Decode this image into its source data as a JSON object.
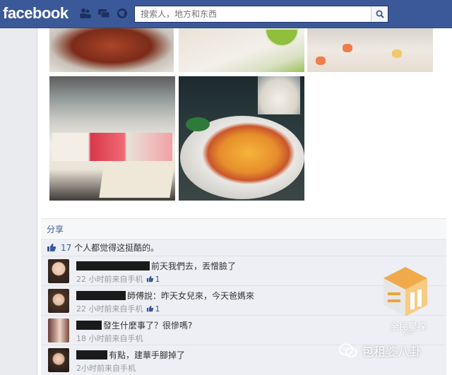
{
  "header": {
    "logo": "facebook",
    "search_placeholder": "搜索人，地方和东西"
  },
  "post": {
    "share_label": "分享",
    "likes_count": "17",
    "likes_suffix": "个人都觉得这挺酷的。"
  },
  "comments": [
    {
      "text": "前天我們去，丟憎臉了",
      "time": "22 小时前来自手机",
      "likes": "1"
    },
    {
      "text": "師傅說：昨天女兒來，今天爸媽來",
      "time": "22 小时前来自手机",
      "likes": "1"
    },
    {
      "text": "發生什麼事了？很慘嗎?",
      "time": "18 小时前来自手机",
      "likes": ""
    },
    {
      "text": "有點，建華手腳掉了",
      "time": "2小时前来自手机",
      "likes": ""
    }
  ],
  "watermark": {
    "app_name": "全民星探",
    "app_tag": "APP",
    "account": "包租婆八卦"
  },
  "colors": {
    "brand": "#3b5998",
    "link": "#3b5998",
    "background": "#e9ebee"
  },
  "icons": [
    "friends-icon",
    "messages-icon",
    "globe-icon",
    "search-icon",
    "thumbs-up-icon"
  ]
}
